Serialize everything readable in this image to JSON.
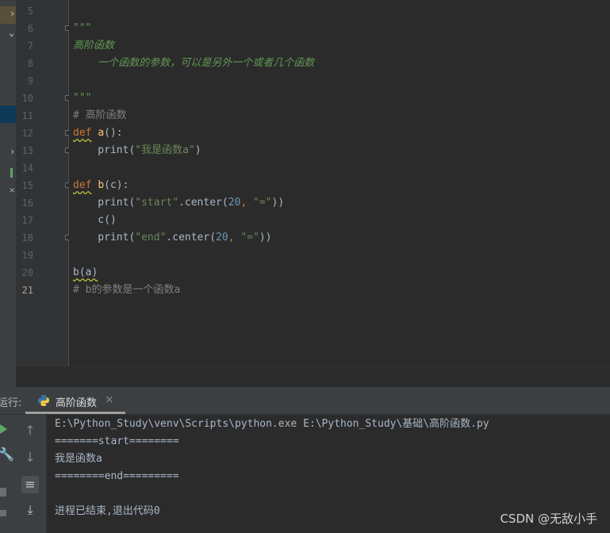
{
  "editor": {
    "lines": [
      {
        "num": "5",
        "tokens": []
      },
      {
        "num": "6",
        "tokens": [
          {
            "t": "\"\"\"",
            "c": "doc"
          }
        ]
      },
      {
        "num": "7",
        "tokens": [
          {
            "t": "高阶函数",
            "c": "doc"
          }
        ]
      },
      {
        "num": "8",
        "tokens": [
          {
            "t": "    一个函数的参数，可以是另外一个或者几个函数",
            "c": "doc"
          }
        ]
      },
      {
        "num": "9",
        "tokens": []
      },
      {
        "num": "10",
        "tokens": [
          {
            "t": "\"\"\"",
            "c": "doc"
          }
        ]
      },
      {
        "num": "11",
        "tokens": [
          {
            "t": "# 高阶函数",
            "c": "cmt"
          }
        ]
      },
      {
        "num": "12",
        "tokens": [
          {
            "t": "def",
            "c": "kw squig"
          },
          {
            "t": " ",
            "c": "plain"
          },
          {
            "t": "a",
            "c": "fn"
          },
          {
            "t": "():",
            "c": "plain"
          }
        ]
      },
      {
        "num": "13",
        "tokens": [
          {
            "t": "    print(",
            "c": "plain"
          },
          {
            "t": "\"我是函数a\"",
            "c": "str"
          },
          {
            "t": ")",
            "c": "plain"
          }
        ]
      },
      {
        "num": "14",
        "tokens": []
      },
      {
        "num": "15",
        "tokens": [
          {
            "t": "def",
            "c": "kw squig"
          },
          {
            "t": " ",
            "c": "plain"
          },
          {
            "t": "b",
            "c": "fn"
          },
          {
            "t": "(c):",
            "c": "plain"
          }
        ]
      },
      {
        "num": "16",
        "tokens": [
          {
            "t": "    print(",
            "c": "plain"
          },
          {
            "t": "\"start\"",
            "c": "str"
          },
          {
            "t": ".center(",
            "c": "plain"
          },
          {
            "t": "20",
            "c": "num"
          },
          {
            "t": ", ",
            "c": "kw"
          },
          {
            "t": "\"=\"",
            "c": "str"
          },
          {
            "t": "))",
            "c": "plain"
          }
        ]
      },
      {
        "num": "17",
        "tokens": [
          {
            "t": "    c()",
            "c": "plain"
          }
        ]
      },
      {
        "num": "18",
        "tokens": [
          {
            "t": "    print(",
            "c": "plain"
          },
          {
            "t": "\"end\"",
            "c": "str"
          },
          {
            "t": ".center(",
            "c": "plain"
          },
          {
            "t": "20",
            "c": "num"
          },
          {
            "t": ", ",
            "c": "kw"
          },
          {
            "t": "\"=\"",
            "c": "str"
          },
          {
            "t": "))",
            "c": "plain"
          }
        ]
      },
      {
        "num": "19",
        "tokens": []
      },
      {
        "num": "20",
        "tokens": [
          {
            "t": "b(a)",
            "c": "plain squig"
          }
        ]
      },
      {
        "num": "21",
        "tokens": [
          {
            "t": "# b的参数是一个函数a",
            "c": "cmt"
          }
        ]
      }
    ],
    "current_line": "21"
  },
  "run_panel": {
    "label": "运行:",
    "tab_title": "高阶函数",
    "tab_close": "×",
    "tab_icon": "python-icon",
    "tool_icons": [
      "rerun-icon",
      "wrench-icon",
      "stop-icon",
      "up-arrow-icon",
      "down-arrow-icon",
      "soft-wrap-icon",
      "scroll-to-end-icon"
    ]
  },
  "console": {
    "lines": [
      "E:\\Python_Study\\venv\\Scripts\\python.exe E:\\Python_Study\\基础\\高阶函数.py",
      "=======start========",
      "我是函数a",
      "========end=========",
      "",
      "进程已结束,退出代码0"
    ]
  },
  "watermark": "CSDN @无敌小手",
  "colors": {
    "editor_bg": "#2b2b2b",
    "keyword": "#cc7832",
    "function": "#ffc66d",
    "string": "#6a8759",
    "number": "#6897bb",
    "docstring": "#629755",
    "comment": "#808080",
    "run_icon": "#59a869"
  }
}
